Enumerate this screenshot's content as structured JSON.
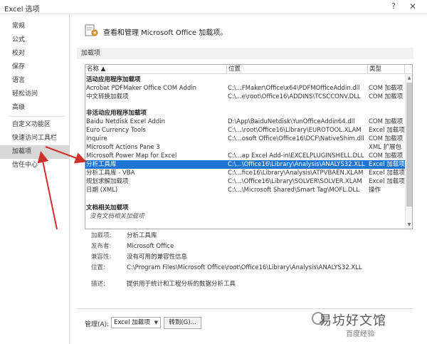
{
  "window": {
    "title": "Excel 选项",
    "help_glyph": "?",
    "close_glyph": "✕"
  },
  "sidebar": {
    "items": [
      {
        "label": "常规"
      },
      {
        "label": "公式"
      },
      {
        "label": "校对"
      },
      {
        "label": "保存"
      },
      {
        "label": "语言"
      },
      {
        "label": "轻松访问"
      },
      {
        "label": "高级"
      },
      {
        "label": "自定义功能区"
      },
      {
        "label": "快速访问工具栏"
      },
      {
        "label": "加载项",
        "active": true
      },
      {
        "label": "信任中心"
      }
    ]
  },
  "header": {
    "text": "查看和管理 Microsoft Office 加载项。",
    "icon": "gear-icon"
  },
  "section": {
    "label": "加载项"
  },
  "table": {
    "columns": {
      "name": "名称 ▲",
      "location": "位置",
      "type": "类型"
    },
    "groups": {
      "active": "活动应用程序加载项",
      "inactive": "非活动应用程序加载项",
      "document": "文档相关加载项",
      "document_none": "没有文档相关加载项"
    },
    "active_rows": [
      {
        "name": "Acrobat PDFMaker Office COM Addin",
        "location": "C:\\...FMaker\\Office\\x64\\PDFMOfficeAddin.dll",
        "type": "COM 加载项"
      },
      {
        "name": "中文转换加载项",
        "location": "C:\\...e\\root\\Office16\\ADDINS\\TCSCCONV.DLL",
        "type": "COM 加载项"
      }
    ],
    "inactive_rows": [
      {
        "name": "Baidu Netdisk Excel Addin",
        "location": "D:\\App\\BaiduNetdisk\\YunOfficeAddin64.dll",
        "type": "COM 加载项"
      },
      {
        "name": "Euro Currency Tools",
        "location": "C:\\...\\root\\Office16\\Library\\EUROTOOL.XLAM",
        "type": "Excel 加载项"
      },
      {
        "name": "Inquire",
        "location": "C:\\...osoft Office\\Office16\\DCF\\NativeShim.dll",
        "type": "COM 加载项"
      },
      {
        "name": "Microsoft Actions Pane 3",
        "location": "",
        "type": "XML 扩展包"
      },
      {
        "name": "Microsoft Power Map for Excel",
        "location": "C:\\...ap Excel Add-in\\EXCELPLUGINSHELL.DLL",
        "type": "COM 加载项"
      },
      {
        "name": "分析工具库",
        "location": "C:\\...\\Office16\\Library\\Analysis\\ANALYS32.XLL",
        "type": "Excel 加载项",
        "selected": true
      },
      {
        "name": "分析工具库 - VBA",
        "location": "C:\\...fice16\\Library\\Analysis\\ATPVBAEN.XLAM",
        "type": "Excel 加载项"
      },
      {
        "name": "规划求解加载项",
        "location": "C:\\...\\Office16\\Library\\SOLVER\\SOLVER.XLAM",
        "type": "Excel 加载项"
      },
      {
        "name": "日期 (XML)",
        "location": "C:\\...\\Microsoft Shared\\Smart Tag\\MOFL.DLL",
        "type": "操作"
      }
    ]
  },
  "details": {
    "addin": {
      "label": "加载项:",
      "value": "分析工具库"
    },
    "publisher": {
      "label": "发布者:",
      "value": "Microsoft Office"
    },
    "compatibility": {
      "label": "兼容性:",
      "value": "没有可用的兼容性信息"
    },
    "location": {
      "label": "位置:",
      "value": "C:\\Program Files\\Microsoft Office\\root\\Office16\\Library\\Analysis\\ANALYS32.XLL"
    },
    "description": {
      "label": "描述:",
      "value": "提供用于统计和工程分析的数据分析工具"
    }
  },
  "manage": {
    "label": "管理(A):",
    "selected": "Excel 加载项",
    "go_label": "转到(G)..."
  },
  "watermark": {
    "line1": "易坊好文馆",
    "line2": "百度经验"
  },
  "colors": {
    "selection": "#1e74d2",
    "sidebar_active": "#d7d7d7",
    "annotation_arrow": "#d0302b"
  }
}
